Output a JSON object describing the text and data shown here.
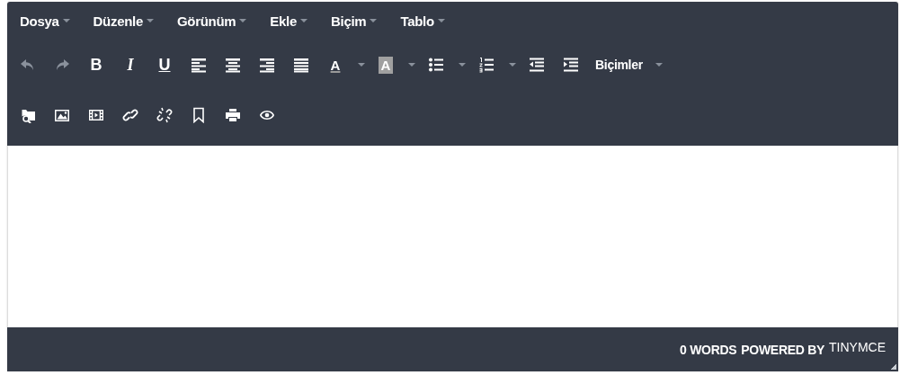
{
  "menubar": [
    {
      "label": "Dosya"
    },
    {
      "label": "Düzenle"
    },
    {
      "label": "Görünüm"
    },
    {
      "label": "Ekle"
    },
    {
      "label": "Biçim"
    },
    {
      "label": "Tablo"
    }
  ],
  "toolbar": [
    [
      {
        "kind": "icon",
        "disabled": true,
        "split": false
      },
      {
        "kind": "icon",
        "disabled": true,
        "split": false
      },
      {
        "kind": "glyph",
        "label": "B",
        "disabled": false,
        "split": false
      },
      {
        "kind": "glyph",
        "label": "I",
        "disabled": false,
        "split": false
      },
      {
        "kind": "glyph",
        "label": "U",
        "disabled": false,
        "split": false
      },
      {
        "kind": "icon",
        "disabled": false,
        "split": false
      },
      {
        "kind": "icon",
        "disabled": false,
        "split": false
      },
      {
        "kind": "icon",
        "disabled": false,
        "split": false
      },
      {
        "kind": "icon",
        "disabled": false,
        "split": false
      },
      {
        "kind": "text-color",
        "label": "A",
        "disabled": false,
        "split": true
      },
      {
        "kind": "highlight-color",
        "label": "A",
        "disabled": false,
        "split": true
      },
      {
        "kind": "icon",
        "disabled": false,
        "split": true
      },
      {
        "kind": "icon",
        "disabled": false,
        "split": true
      },
      {
        "kind": "icon",
        "disabled": false,
        "split": false
      },
      {
        "kind": "icon",
        "disabled": false,
        "split": false
      },
      {
        "kind": "menu",
        "label": "Biçimler",
        "disabled": false,
        "split": true
      }
    ],
    [
      {
        "kind": "icon",
        "disabled": false,
        "split": false
      },
      {
        "kind": "icon",
        "disabled": false,
        "split": false
      },
      {
        "kind": "icon",
        "disabled": false,
        "split": false
      },
      {
        "kind": "icon",
        "disabled": false,
        "split": false
      },
      {
        "kind": "icon",
        "disabled": false,
        "split": false
      },
      {
        "kind": "icon",
        "disabled": false,
        "split": false
      },
      {
        "kind": "icon",
        "disabled": false,
        "split": false
      },
      {
        "kind": "icon",
        "disabled": false,
        "split": false
      }
    ]
  ],
  "status_bar": {
    "word_count": "0 WORDS",
    "powered_by": "POWERED BY",
    "brand": "TINYMCE"
  }
}
